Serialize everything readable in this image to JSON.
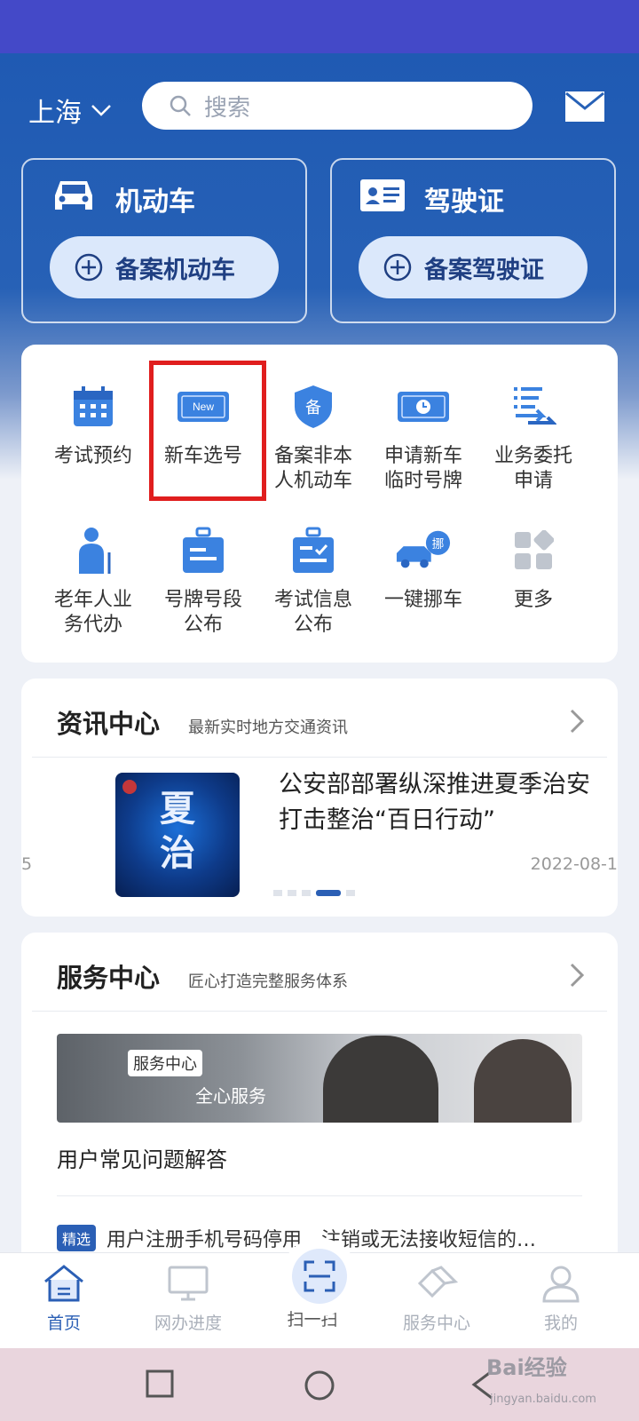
{
  "header": {
    "city": "上海",
    "search_placeholder": "搜索"
  },
  "top_cards": [
    {
      "title": "机动车",
      "action": "备案机动车",
      "icon": "car-icon"
    },
    {
      "title": "驾驶证",
      "action": "备案驾驶证",
      "icon": "license-icon"
    }
  ],
  "services": [
    {
      "label": "考试预约",
      "icon": "calendar-icon"
    },
    {
      "label": "新车选号",
      "icon": "new-plate-icon",
      "highlighted": true
    },
    {
      "label": "备案非本\n人机动车",
      "icon": "shield-icon"
    },
    {
      "label": "申请新车\n临时号牌",
      "icon": "temp-plate-icon"
    },
    {
      "label": "业务委托\n申请",
      "icon": "delegate-icon"
    },
    {
      "label": "老年人业\n务代办",
      "icon": "elderly-icon"
    },
    {
      "label": "号牌号段\n公布",
      "icon": "plate-range-icon"
    },
    {
      "label": "考试信息\n公布",
      "icon": "exam-info-icon"
    },
    {
      "label": "一键挪车",
      "icon": "move-car-icon"
    },
    {
      "label": "更多",
      "icon": "more-icon"
    }
  ],
  "news": {
    "title": "资讯中心",
    "subtitle": "最新实时地方交通资讯",
    "headline": "公安部部署纵深推进夏季治安打击整治“百日行动”",
    "date": "2022-08-1",
    "prev_fragment": "5",
    "active_slide": 4,
    "slide_count": 5
  },
  "service_center": {
    "title": "服务中心",
    "subtitle": "匠心打造完整服务体系",
    "banner_tag": "服务中心",
    "banner_text": "全心服务",
    "faq_title": "用户常见问题解答",
    "featured_tag": "精选",
    "featured_text": "用户注册手机号码停用、注销或无法接收短信的…"
  },
  "tabs": [
    {
      "label": "首页",
      "icon": "home-icon",
      "active": true
    },
    {
      "label": "网办进度",
      "icon": "monitor-icon"
    },
    {
      "label": "扫一扫",
      "icon": "scan-icon"
    },
    {
      "label": "服务中心",
      "icon": "service-icon"
    },
    {
      "label": "我的",
      "icon": "user-icon"
    }
  ],
  "watermark": {
    "text": "Bai经验",
    "url": "jingyan.baidu.com"
  },
  "colors": {
    "brand_blue": "#2b5fb5",
    "highlight_red": "#e01e1e"
  }
}
